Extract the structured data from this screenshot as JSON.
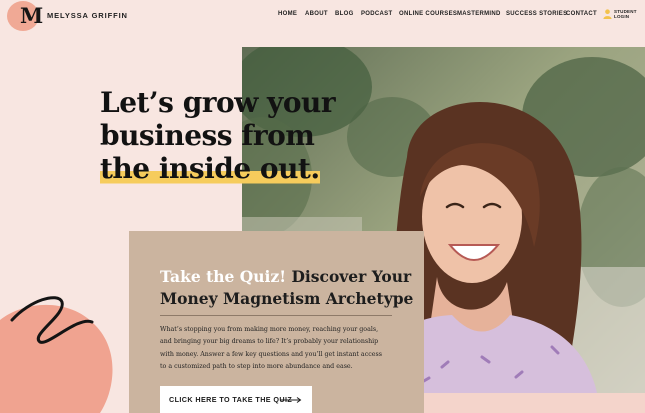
{
  "brand": {
    "logo_letter": "M",
    "name": "MELYSSA GRIFFIN"
  },
  "nav": {
    "items": [
      "HOME",
      "ABOUT",
      "BLOG",
      "PODCAST",
      "ONLINE COURSES",
      "MASTERMIND",
      "SUCCESS STORIES",
      "CONTACT"
    ],
    "login_line1": "STUDENT",
    "login_line2": "LOGIN"
  },
  "hero": {
    "headline_line1": "Let’s grow your",
    "headline_line2": "business from",
    "headline_line3": "the inside out."
  },
  "quiz": {
    "title_highlight": "Take the Quiz!",
    "title_rest_line1": "Discover Your",
    "title_rest_line2": "Money Magnetism Archetype",
    "body_lines": [
      "What’s stopping you from making more money, reaching your goals,",
      "and bringing your big dreams to life? It’s probably your relationship",
      "with money. Answer a few key questions and you’ll get instant access",
      "to a customized path to step into more abundance and ease."
    ],
    "cta_label": "CLICK HERE TO TAKE THE QUIZ"
  },
  "colors": {
    "background": "#f8e6e1",
    "logo_circle": "#f0a995",
    "highlight": "#f6cc5c",
    "card": "#cbb49f",
    "blob": "#f0a390"
  }
}
